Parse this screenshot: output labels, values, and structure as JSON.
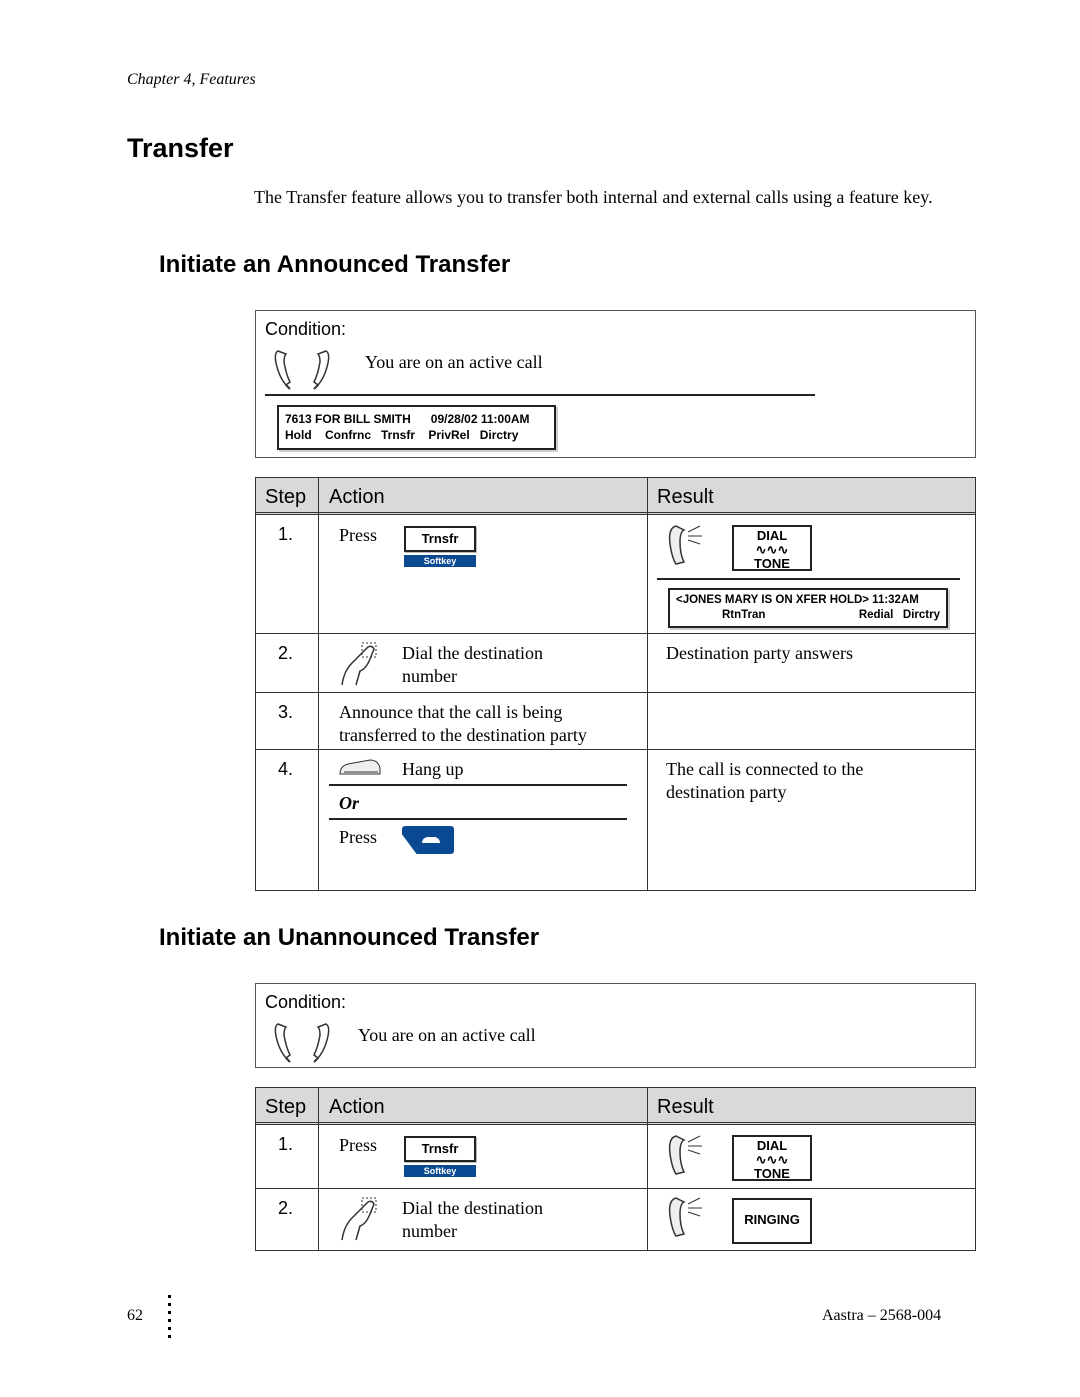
{
  "header": {
    "chapter": "Chapter 4, Features"
  },
  "title": "Transfer",
  "intro": "The Transfer feature allows you to transfer both internal and external calls using a feature key.",
  "section1": {
    "heading": "Initiate an Announced Transfer",
    "condition_label": "Condition:",
    "condition_text": "You are on an active call",
    "display": {
      "line1": "7613 FOR BILL SMITH      09/28/02 11:00AM",
      "line2": "Hold    Confrnc   Trnsfr    PrivRel   Dirctry"
    },
    "columns": [
      "Step",
      "Action",
      "Result"
    ],
    "rows": [
      {
        "step": "1.",
        "action_press": "Press",
        "key_label": "Trnsfr",
        "key_sub": "Softkey",
        "tone_top": "DIAL",
        "tone_bottom": "TONE",
        "display_line1": "<JONES MARY IS ON XFER HOLD> 11:32AM",
        "display_line2": "RtnTran",
        "display_line2b": "Redial   Dirctry"
      },
      {
        "step": "2.",
        "action": "Dial the destination number",
        "result": "Destination party answers"
      },
      {
        "step": "3.",
        "action": "Announce that the call is being transferred to the destination party",
        "result": ""
      },
      {
        "step": "4.",
        "action_hang": "Hang up",
        "or": "Or",
        "action_press": "Press",
        "result": "The call is connected to the destination party"
      }
    ]
  },
  "section2": {
    "heading": "Initiate an Unannounced Transfer",
    "condition_label": "Condition:",
    "condition_text": "You are on an active call",
    "columns": [
      "Step",
      "Action",
      "Result"
    ],
    "rows": [
      {
        "step": "1.",
        "action_press": "Press",
        "key_label": "Trnsfr",
        "key_sub": "Softkey",
        "tone_top": "DIAL",
        "tone_bottom": "TONE"
      },
      {
        "step": "2.",
        "action": "Dial the destination number",
        "result_display": "RINGING"
      }
    ]
  },
  "footer": {
    "page": "62",
    "doc": "Aastra – 2568-004"
  },
  "colors": {
    "softkey": "#0b4a92",
    "header_fill": "#d9d9d9"
  }
}
